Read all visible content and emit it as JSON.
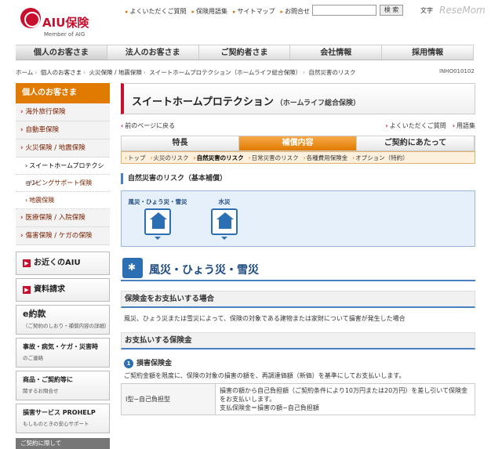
{
  "header": {
    "brand": "AIU保険",
    "member": "Member of AIG",
    "links": [
      "よくいただくご質問",
      "保険用語集",
      "サイトマップ",
      "お問合せ"
    ],
    "search_button": "検 索",
    "text_size": "文字",
    "watermark": "ReseMom"
  },
  "gnav": [
    "個人のお客さま",
    "法人のお客さま",
    "ご契約者さま",
    "会社情報",
    "採用情報"
  ],
  "breadcrumb": [
    "ホーム",
    "個人のお客さま",
    "火災保険 / 地震保険",
    "スイートホームプロテクション（ホームライフ総合保険）",
    "自然災害のリスク"
  ],
  "page_id": "INHO010102",
  "sidebar": {
    "head": "個人のお客さま",
    "items": [
      "海外旅行保険",
      "自動車保険",
      "火災保険 / 地震保険"
    ],
    "subs": [
      "スイートホームプロテクション",
      "リビングサポート保険",
      "地震保険"
    ],
    "items2": [
      "医療保険 / 入院保険",
      "傷害保険 / ケガの保険"
    ],
    "banners": [
      "お近くのAIU",
      "資料請求",
      "e約款"
    ],
    "eyaku_note": "（ご契約のしおり・補償内容の詳細）",
    "banner2": {
      "title": "事故・病気・ケガ・災害時",
      "sub": "のご連絡"
    },
    "banner3": {
      "title": "商品・ご契約等に",
      "sub": "関するお問合せ"
    },
    "banner4": {
      "title": "損害サービス PROHELP",
      "sub": "もしものときの安心サポート"
    },
    "foot": "ご契約に際して"
  },
  "main": {
    "title": "スイートホームプロテクション",
    "title_sub": "（ホームライフ総合保険）",
    "back": "前のページに戻る",
    "right_links": [
      "よくいただくご質問",
      "用語集"
    ],
    "tabs": [
      "特長",
      "補償内容",
      "ご契約にあたって"
    ],
    "subtabs": [
      "トップ",
      "火災のリスク",
      "自然災害のリスク",
      "日常災害のリスク",
      "各種費用保険金",
      "オプション（特約）"
    ],
    "section": "自然災害のリスク（基本補償）",
    "risks": [
      "風災・ひょう災・雪災",
      "水災"
    ],
    "big_heading": "風災・ひょう災・雪災",
    "bar1": "保険金をお支払いする場合",
    "para1": "風災、ひょう災または雪災によって、保険の対象である建物または家財について損害が発生した場合",
    "bar2": "お支払いする保険金",
    "num": "1",
    "num_title": "損害保険金",
    "para2": "ご契約金額を限度に、保険の対象の損害の額を、再調達価額（新価）を基準にしてお支払いします。",
    "table": {
      "key": "I型−自己負担型",
      "lines": [
        "損害の額から自己負担額（ご契約条件により10万円または20万円）を差し引いて保険金をお支払いします。",
        "支払保険金＝損害の額−自己負担額"
      ]
    }
  }
}
